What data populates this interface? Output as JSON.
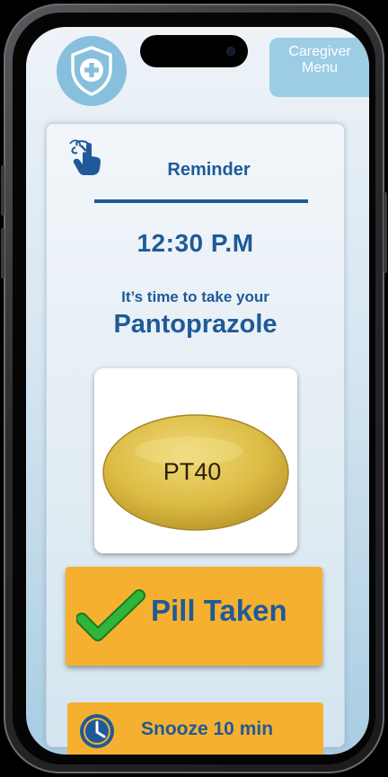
{
  "header": {
    "caregiver_menu_line1": "Caregiver",
    "caregiver_menu_line2": "Menu"
  },
  "reminder": {
    "title": "Reminder",
    "time": "12:30 P.M",
    "message": "It’s time to  take your",
    "medication_name": "Pantoprazole",
    "pill_imprint": "PT40"
  },
  "actions": {
    "pill_taken_label": "Pill Taken",
    "snooze_label": "Snooze 10 min"
  },
  "icons": {
    "logo": "shield-plus-icon",
    "reminder": "finger-string-icon",
    "taken": "checkmark-icon",
    "snooze": "clock-icon"
  },
  "colors": {
    "accent_blue": "#1f5a98",
    "button_orange": "#f6b02f",
    "logo_bg": "#87bfdc",
    "caregiver_bg": "#9ccde5",
    "check_green": "#2fb53a"
  }
}
